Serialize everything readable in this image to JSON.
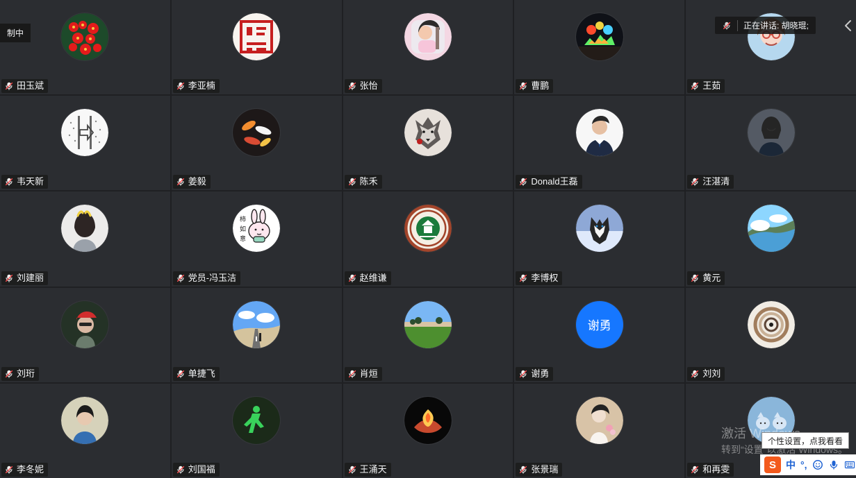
{
  "overlay": {
    "recording_label": "制中",
    "speaker_label": "正在讲话: 胡晓琨;",
    "watermark_title": "激活 Windows",
    "watermark_subtitle": "转到“设置”以激活 Windows。",
    "tooltip_text": "个性设置，点我看看",
    "ime_mode": "中",
    "ime_punct": "°,"
  },
  "participants": [
    {
      "name": "田玉斌",
      "avatar": "flowers"
    },
    {
      "name": "李亚楠",
      "avatar": "seal"
    },
    {
      "name": "张怡",
      "avatar": "child"
    },
    {
      "name": "曹鹏",
      "avatar": "night-lights"
    },
    {
      "name": "王茹",
      "avatar": "cartoon-girl"
    },
    {
      "name": "韦天新",
      "avatar": "sketch-arrow"
    },
    {
      "name": "姜毅",
      "avatar": "koi"
    },
    {
      "name": "陈禾",
      "avatar": "wolf"
    },
    {
      "name": "Donald王磊",
      "avatar": "man-suit"
    },
    {
      "name": "汪湛清",
      "avatar": "woman-portrait"
    },
    {
      "name": "刘建丽",
      "avatar": "woman-ears"
    },
    {
      "name": "党员-冯玉洁",
      "avatar": "bunny-sticker"
    },
    {
      "name": "赵维谦",
      "avatar": "university-logo"
    },
    {
      "name": "李博权",
      "avatar": "husky"
    },
    {
      "name": "黄元",
      "avatar": "landscape"
    },
    {
      "name": "刘珩",
      "avatar": "woman-cap"
    },
    {
      "name": "单捷飞",
      "avatar": "road"
    },
    {
      "name": "肖烜",
      "avatar": "field"
    },
    {
      "name": "谢勇",
      "avatar": "text",
      "avatar_text": "谢勇"
    },
    {
      "name": "刘刘",
      "avatar": "staircase"
    },
    {
      "name": "李冬妮",
      "avatar": "woman-trees"
    },
    {
      "name": "刘国福",
      "avatar": "green-man"
    },
    {
      "name": "王涌天",
      "avatar": "fire-hands"
    },
    {
      "name": "张景瑞",
      "avatar": "woman-flowers"
    },
    {
      "name": "和再雯",
      "avatar": "cats"
    }
  ],
  "colors": {
    "tile_bg": "#2b2d31",
    "page_bg": "#1f2023",
    "badge_bg": "#191919",
    "text_avatar_bg": "#1677ff",
    "mic_red": "#ff4d4f"
  }
}
